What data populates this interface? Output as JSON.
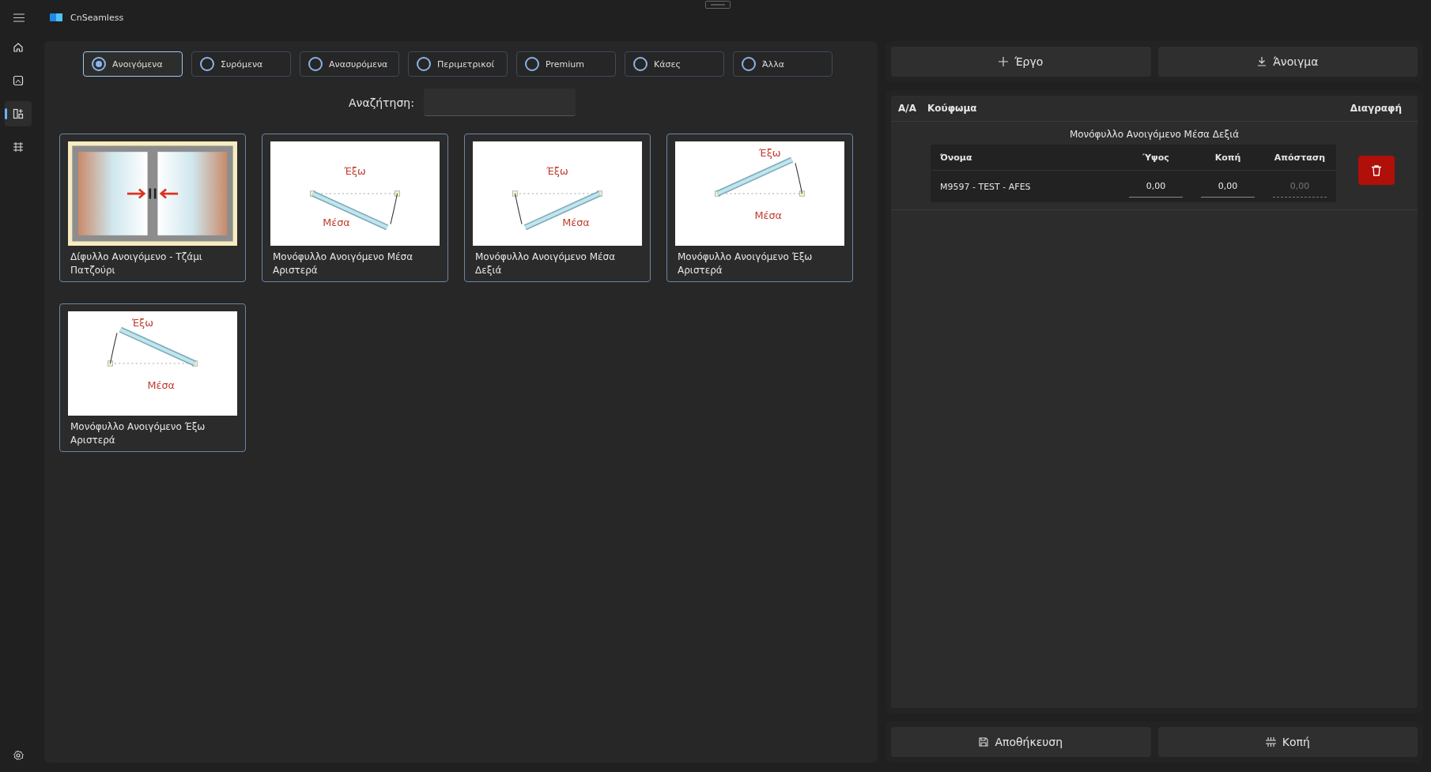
{
  "window": {
    "title": "CnSeamless"
  },
  "nav_items": [
    {
      "selected": false
    },
    {
      "selected": false
    },
    {
      "selected": true
    },
    {
      "selected": false
    }
  ],
  "categories": [
    {
      "label": "Ανοιγόμενα",
      "selected": true
    },
    {
      "label": "Συρόμενα",
      "selected": false
    },
    {
      "label": "Ανασυρόμενα",
      "selected": false
    },
    {
      "label": "Περιμετρικοί",
      "selected": false
    },
    {
      "label": "Premium",
      "selected": false
    },
    {
      "label": "Κάσες",
      "selected": false
    },
    {
      "label": "Άλλα",
      "selected": false
    }
  ],
  "search": {
    "label": "Αναζήτηση:"
  },
  "products": [
    {
      "kind": "double",
      "name": "Δίφυλλο Ανοιγόμενο - Τζάμι Πατζούρι"
    },
    {
      "kind": "single",
      "opens_out": false,
      "hinge_right": false,
      "outside": "Έξω",
      "inside": "Μέσα",
      "name": "Μονόφυλλο Ανοιγόμενο Μέσα Αριστερά"
    },
    {
      "kind": "single",
      "opens_out": false,
      "hinge_right": true,
      "outside": "Έξω",
      "inside": "Μέσα",
      "name": "Μονόφυλλο Ανοιγόμενο Μέσα Δεξιά"
    },
    {
      "kind": "single",
      "opens_out": true,
      "hinge_right": false,
      "outside": "Έξω",
      "inside": "Μέσα",
      "name": "Μονόφυλλο Ανοιγόμενο Έξω Αριστερά"
    },
    {
      "kind": "single",
      "opens_out": true,
      "hinge_right": true,
      "outside": "Έξω",
      "inside": "Μέσα",
      "name": "Μονόφυλλο Ανοιγόμενο Έξω Αριστερά"
    }
  ],
  "actions_top": [
    {
      "label": "Έργο",
      "kind": "add"
    },
    {
      "label": "Άνοιγμα",
      "kind": "download"
    }
  ],
  "table": {
    "columns": [
      "Α/Α",
      "Κούφωμα",
      "Διαγραφή"
    ],
    "groups": [
      {
        "title": "Μονόφυλλο Ανοιγόμενο Μέσα Δεξιά",
        "columns": [
          "Όνομα",
          "Ύψος",
          "Κοπή",
          "Απόσταση"
        ],
        "rows": [
          {
            "name": "M9597 - TEST - AFES",
            "fields": [
              {
                "value": "0,00",
                "disabled": false
              },
              {
                "value": "0,00",
                "disabled": false
              },
              {
                "value": "0,00",
                "disabled": true
              }
            ]
          }
        ]
      }
    ]
  },
  "actions_bottom": [
    {
      "label": "Αποθήκευση",
      "kind": "save"
    },
    {
      "label": "Κοπή",
      "kind": "cut"
    }
  ]
}
